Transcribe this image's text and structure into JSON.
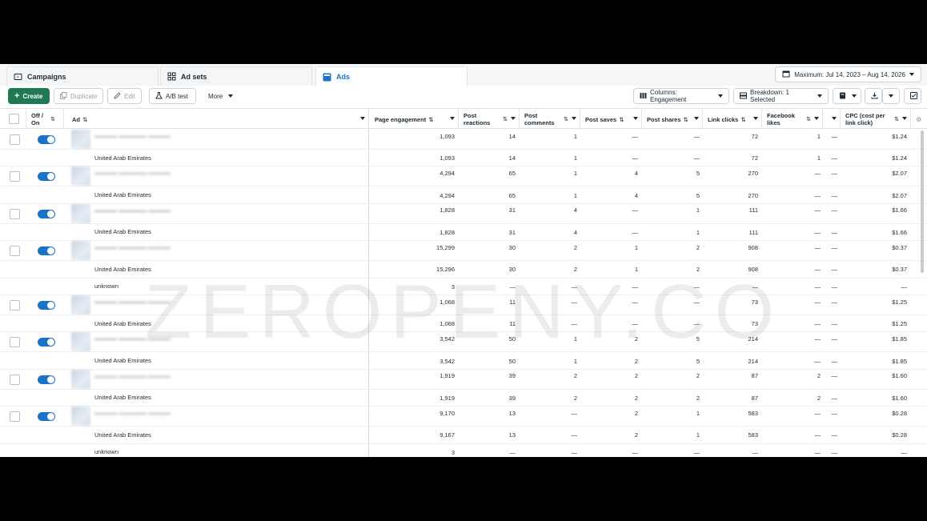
{
  "tabs": [
    {
      "label": "Campaigns",
      "icon": "folder-icon"
    },
    {
      "label": "Ad sets",
      "icon": "grid-icon"
    },
    {
      "label": "Ads",
      "icon": "ad-icon",
      "active": true
    }
  ],
  "date_range": "Maximum: Jul 14, 2023 – Aug 14, 2026",
  "toolbar": {
    "create": "Create",
    "duplicate": "Duplicate",
    "edit": "Edit",
    "ab_test": "A/B test",
    "more": "More",
    "columns": "Columns: Engagement",
    "breakdown": "Breakdown: 1 Selected"
  },
  "columns": {
    "off_on": "Off / On",
    "ad": "Ad",
    "page_engagement": "Page engagement",
    "post_reactions": "Post reactions",
    "post_comments": "Post comments",
    "post_saves": "Post saves",
    "post_shares": "Post shares",
    "link_clicks": "Link clicks",
    "facebook_likes": "Facebook likes",
    "cpc": "CPC (cost per link click)"
  },
  "rows": [
    {
      "type": "ad",
      "label": "",
      "v": [
        "1,093",
        "14",
        "1",
        "—",
        "—",
        "72",
        "1",
        "—",
        "$1.24"
      ]
    },
    {
      "type": "sub",
      "label": "United Arab Emirates",
      "v": [
        "1,093",
        "14",
        "1",
        "—",
        "—",
        "72",
        "1",
        "—",
        "$1.24"
      ]
    },
    {
      "type": "ad",
      "label": "",
      "v": [
        "4,294",
        "65",
        "1",
        "4",
        "5",
        "270",
        "—",
        "—",
        "$2.07"
      ]
    },
    {
      "type": "sub",
      "label": "United Arab Emirates",
      "v": [
        "4,294",
        "65",
        "1",
        "4",
        "5",
        "270",
        "—",
        "—",
        "$2.07"
      ]
    },
    {
      "type": "ad",
      "label": "",
      "v": [
        "1,828",
        "31",
        "4",
        "—",
        "1",
        "111",
        "—",
        "—",
        "$1.66"
      ]
    },
    {
      "type": "sub",
      "label": "United Arab Emirates",
      "v": [
        "1,828",
        "31",
        "4",
        "—",
        "1",
        "111",
        "—",
        "—",
        "$1.66"
      ]
    },
    {
      "type": "ad",
      "label": "",
      "v": [
        "15,299",
        "30",
        "2",
        "1",
        "2",
        "908",
        "—",
        "—",
        "$0.37"
      ]
    },
    {
      "type": "sub",
      "label": "United Arab Emirates",
      "v": [
        "15,296",
        "30",
        "2",
        "1",
        "2",
        "908",
        "—",
        "—",
        "$0.37"
      ]
    },
    {
      "type": "sub2",
      "label": "unknown",
      "v": [
        "3",
        "—",
        "—",
        "—",
        "—",
        "—",
        "—",
        "—",
        "—"
      ]
    },
    {
      "type": "ad",
      "label": "",
      "v": [
        "1,068",
        "11",
        "—",
        "—",
        "—",
        "73",
        "—",
        "—",
        "$1.25"
      ]
    },
    {
      "type": "sub",
      "label": "United Arab Emirates",
      "v": [
        "1,068",
        "11",
        "—",
        "—",
        "—",
        "73",
        "—",
        "—",
        "$1.25"
      ]
    },
    {
      "type": "ad",
      "label": "",
      "v": [
        "3,542",
        "50",
        "1",
        "2",
        "5",
        "214",
        "—",
        "—",
        "$1.85"
      ]
    },
    {
      "type": "sub",
      "label": "United Arab Emirates",
      "v": [
        "3,542",
        "50",
        "1",
        "2",
        "5",
        "214",
        "—",
        "—",
        "$1.85"
      ]
    },
    {
      "type": "ad",
      "label": "",
      "v": [
        "1,919",
        "39",
        "2",
        "2",
        "2",
        "87",
        "2",
        "—",
        "$1.60"
      ]
    },
    {
      "type": "sub",
      "label": "United Arab Emirates",
      "v": [
        "1,919",
        "39",
        "2",
        "2",
        "2",
        "87",
        "2",
        "—",
        "$1.60"
      ]
    },
    {
      "type": "ad",
      "label": "",
      "v": [
        "9,170",
        "13",
        "—",
        "2",
        "1",
        "583",
        "—",
        "—",
        "$0.28"
      ]
    },
    {
      "type": "sub",
      "label": "United Arab Emirates",
      "v": [
        "9,167",
        "13",
        "—",
        "2",
        "1",
        "583",
        "—",
        "—",
        "$0.28"
      ]
    },
    {
      "type": "sub2",
      "label": "unknown",
      "v": [
        "3",
        "—",
        "—",
        "—",
        "—",
        "—",
        "—",
        "—",
        "—"
      ]
    }
  ],
  "watermark": "ZEROPENY.CO",
  "colors": {
    "accent": "#1a73c7",
    "create": "#1f7a54",
    "toggle_on": "#1a73c7"
  }
}
